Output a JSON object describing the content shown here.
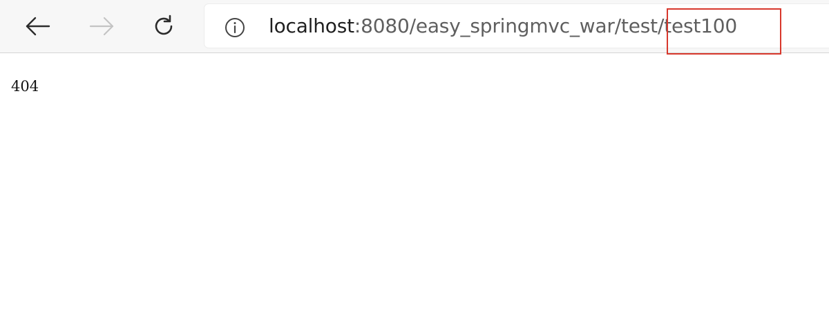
{
  "toolbar": {
    "back_icon": "arrow-left-icon",
    "forward_icon": "arrow-right-icon",
    "reload_icon": "reload-icon"
  },
  "address": {
    "info_icon": "info-circle-icon",
    "host": "localhost",
    "path": ":8080/easy_springmvc_war/test/test100",
    "highlight_color": "#d8372c"
  },
  "page": {
    "body_text": "404"
  }
}
